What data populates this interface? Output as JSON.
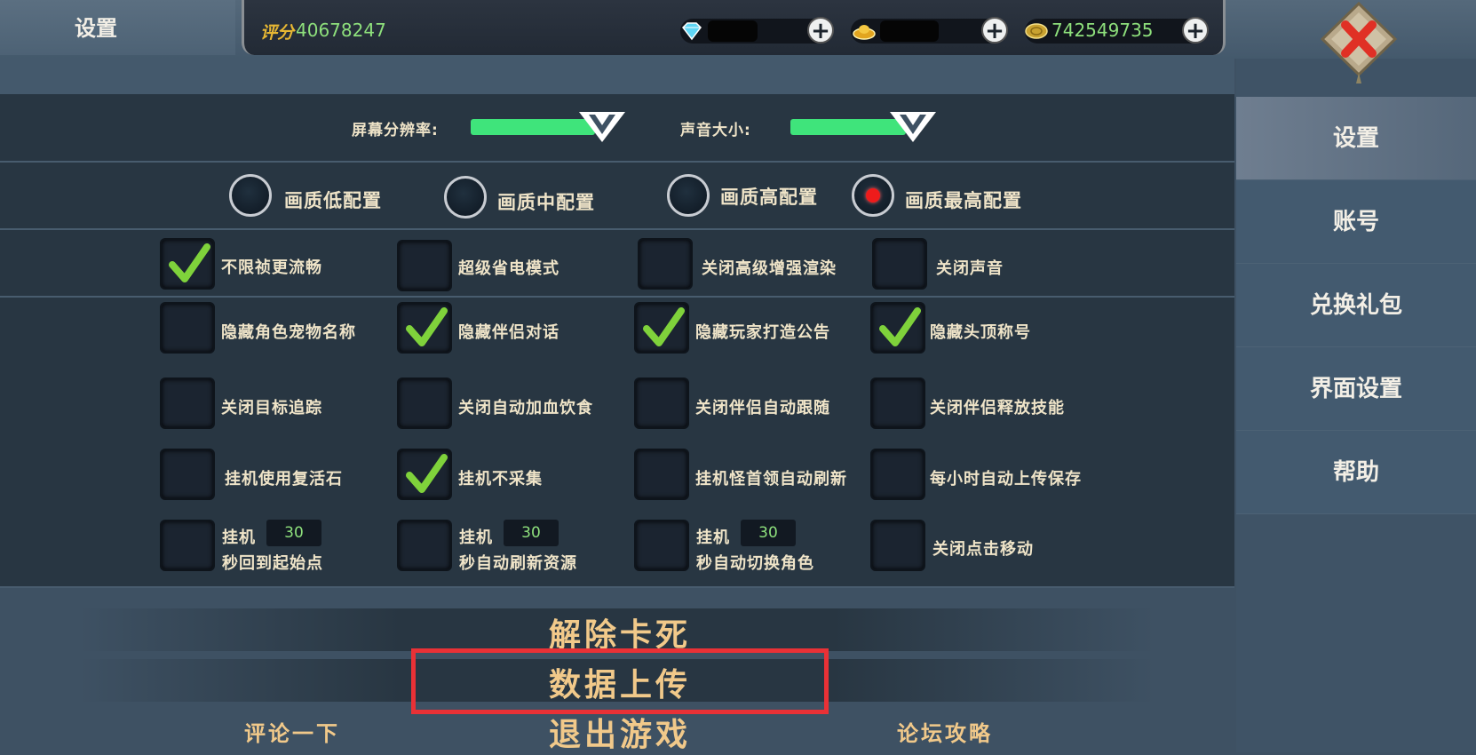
{
  "header": {
    "title": "设置",
    "score_label": "评分",
    "score_value": "40678247",
    "gold_value": "742549735",
    "diamond_icon": "diamond-icon",
    "ingot_icon": "gold-ingot-icon",
    "coin_icon": "coin-icon",
    "plus_symbol": "+"
  },
  "sidebar": {
    "items": [
      {
        "label": "设置"
      },
      {
        "label": "账号"
      },
      {
        "label": "兑换礼包"
      },
      {
        "label": "界面设置"
      },
      {
        "label": "帮助"
      }
    ],
    "active_index": 0
  },
  "sliders": {
    "resolution_label": "屏幕分辨率:",
    "resolution_level": 0.85,
    "volume_label": "声音大小:",
    "volume_level": 0.85
  },
  "quality": {
    "options": [
      "画质低配置",
      "画质中配置",
      "画质高配置",
      "画质最高配置"
    ],
    "selected_index": 3
  },
  "options": {
    "row1": [
      {
        "label": "不限祯更流畅",
        "checked": true
      },
      {
        "label": "超级省电模式",
        "checked": false
      },
      {
        "label": "关闭高级增强渲染",
        "checked": false
      },
      {
        "label": "关闭声音",
        "checked": false
      }
    ],
    "row2": [
      {
        "label": "隐藏角色宠物名称",
        "checked": false
      },
      {
        "label": "隐藏伴侣对话",
        "checked": true
      },
      {
        "label": "隐藏玩家打造公告",
        "checked": true
      },
      {
        "label": "隐藏头顶称号",
        "checked": true
      }
    ],
    "row3": [
      {
        "label": "关闭目标追踪",
        "checked": false
      },
      {
        "label": "关闭自动加血饮食",
        "checked": false
      },
      {
        "label": "关闭伴侣自动跟随",
        "checked": false
      },
      {
        "label": "关闭伴侣释放技能",
        "checked": false
      }
    ],
    "row4": [
      {
        "label": "挂机使用复活石",
        "checked": false
      },
      {
        "label": "挂机不采集",
        "checked": true
      },
      {
        "label": "挂机怪首领自动刷新",
        "checked": false
      },
      {
        "label": "每小时自动上传保存",
        "checked": false
      }
    ],
    "row5": [
      {
        "prefix": "挂机",
        "value": "30",
        "suffix": "秒回到起始点",
        "checked": false
      },
      {
        "prefix": "挂机",
        "value": "30",
        "suffix": "秒自动刷新资源",
        "checked": false
      },
      {
        "prefix": "挂机",
        "value": "30",
        "suffix": "秒自动切换角色",
        "checked": false
      },
      {
        "label": "关闭点击移动",
        "checked": false
      }
    ]
  },
  "bottom": {
    "unstuck": "解除卡死",
    "upload": "数据上传",
    "exit": "退出游戏",
    "comment": "评论一下",
    "forum": "论坛攻略"
  },
  "colors": {
    "accent_green": "#3fe47b",
    "check_green": "#7fd23b",
    "highlight_red": "#e93136",
    "button_text": "#f1c98a"
  }
}
